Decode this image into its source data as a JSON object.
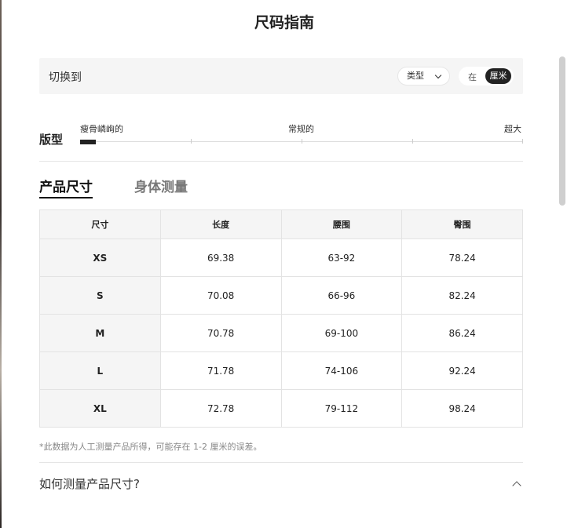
{
  "dialog": {
    "title": "尺码指南"
  },
  "switch": {
    "label": "切换到",
    "type_label": "类型",
    "unit_in": "在",
    "unit_cm": "厘米",
    "selected_unit": "厘米"
  },
  "fit": {
    "title": "版型",
    "labels": [
      "瘦骨嶙峋的",
      "常规的",
      "超大"
    ],
    "selected": "瘦骨嶙峋的"
  },
  "tabs": [
    {
      "label": "产品尺寸",
      "active": true
    },
    {
      "label": "身体测量",
      "active": false
    }
  ],
  "table": {
    "headers": [
      "尺寸",
      "长度",
      "腰围",
      "臀围"
    ],
    "rows": [
      [
        "XS",
        "69.38",
        "63-92",
        "78.24"
      ],
      [
        "S",
        "70.08",
        "66-96",
        "82.24"
      ],
      [
        "M",
        "70.78",
        "69-100",
        "86.24"
      ],
      [
        "L",
        "71.78",
        "74-106",
        "92.24"
      ],
      [
        "XL",
        "72.78",
        "79-112",
        "98.24"
      ]
    ]
  },
  "note": "*此数据为人工测量产品所得，可能存在 1-2 厘米的误差。",
  "accordion": {
    "title": "如何测量产品尺寸?",
    "expanded": true
  },
  "icons": {
    "type_dropdown": "chevron-down-icon",
    "accordion": "chevron-up-icon"
  }
}
